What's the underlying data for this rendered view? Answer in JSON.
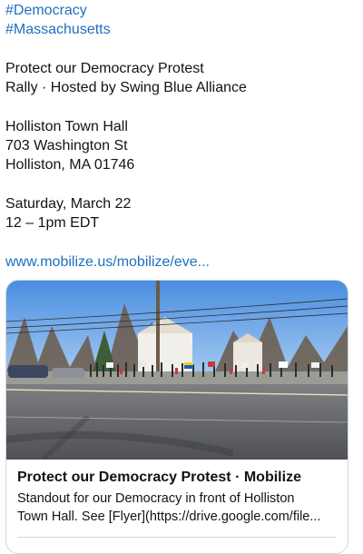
{
  "post": {
    "hashtags": [
      "#Democracy",
      "#Massachusetts"
    ],
    "event_title_line1": "Protect our Democracy Protest",
    "event_title_line2": "Rally · Hosted by Swing Blue Alliance",
    "address": [
      "Holliston Town Hall",
      "703 Washington St",
      "Holliston, MA 01746"
    ],
    "date": "Saturday, March 22",
    "time": "12 – 1pm EDT",
    "link_text": "www.mobilize.us/mobilize/eve..."
  },
  "card": {
    "title": "Protect our Democracy Protest · Mobilize",
    "description_line1": "Standout for our Democracy in front of Holliston",
    "description_line2": "Town Hall. See [Flyer](https://drive.google.com/file..."
  },
  "colors": {
    "link": "#1d6fbf",
    "text": "#0f1419",
    "border": "#cfd9de"
  }
}
